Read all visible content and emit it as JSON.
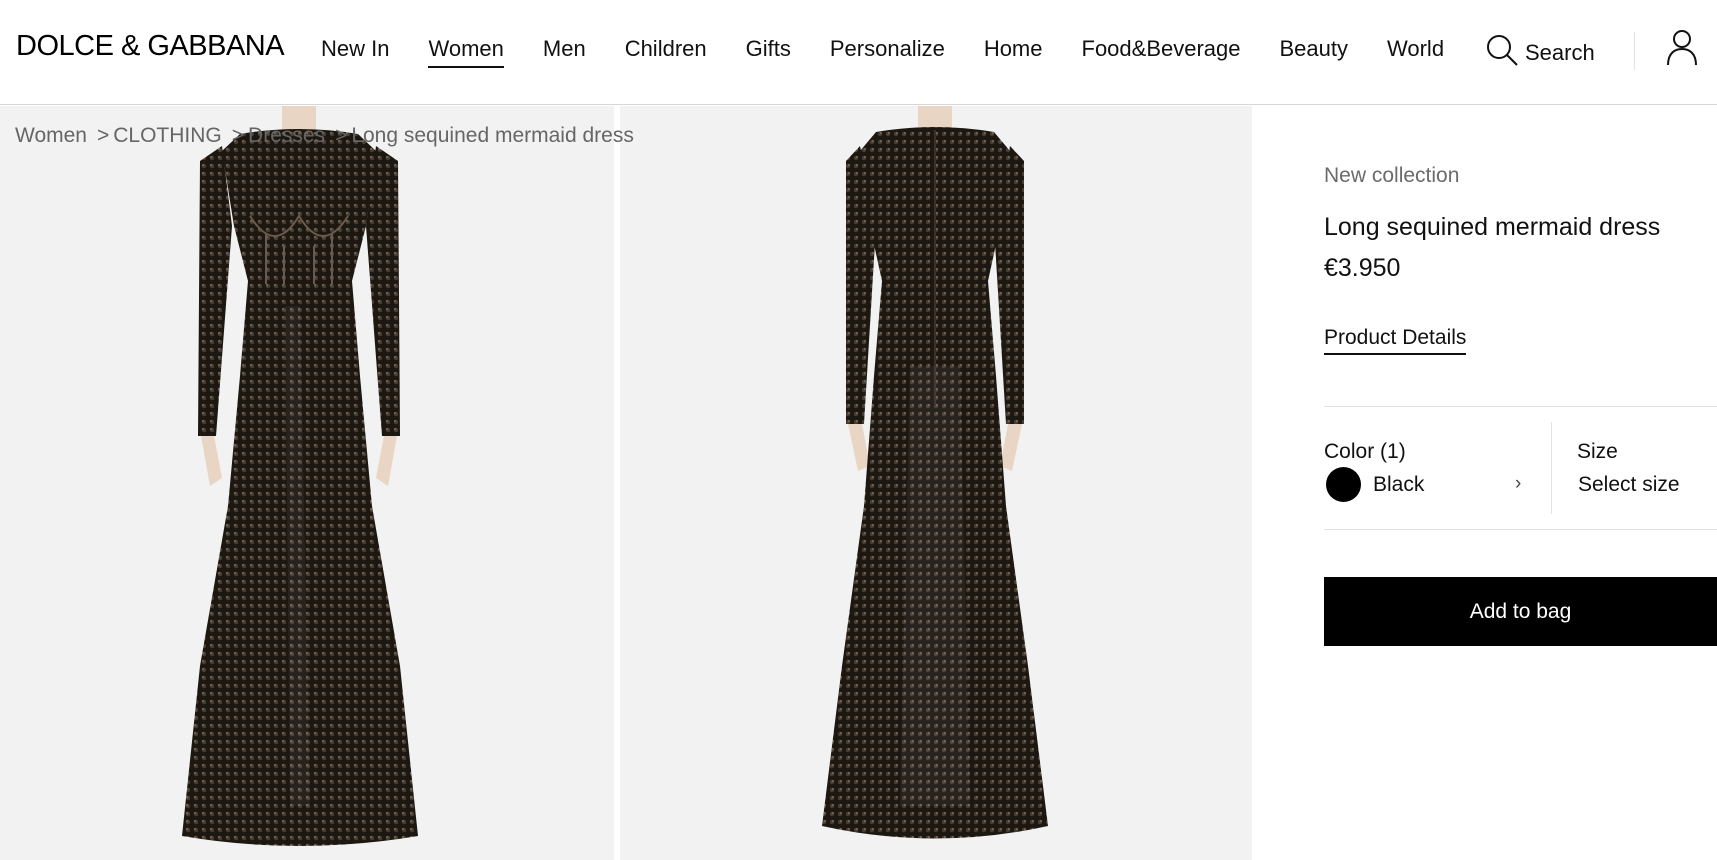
{
  "header": {
    "logo": "DOLCE & GABBANA",
    "nav": [
      "New In",
      "Women",
      "Men",
      "Children",
      "Gifts",
      "Personalize",
      "Home",
      "Food&Beverage",
      "Beauty",
      "World"
    ],
    "active_nav": "Women",
    "search_label": "Search"
  },
  "breadcrumb": {
    "items": [
      "Women",
      "CLOTHING",
      "Dresses"
    ],
    "separator": ">",
    "current": "Long sequined mermaid dress"
  },
  "product": {
    "collection": "New collection",
    "title": "Long sequined mermaid dress",
    "price": "€3.950",
    "details_link": "Product Details",
    "color_label": "Color (1)",
    "color_value": "Black",
    "color_swatch": "#000000",
    "size_label": "Size",
    "size_value": "Select size",
    "add_to_bag": "Add to bag"
  },
  "icons": {
    "search": "search-icon",
    "account": "user-icon",
    "chevron": "chevron-right-icon"
  },
  "colors": {
    "image_background": "#f2f2f2",
    "button_background": "#000000",
    "button_text": "#ffffff"
  }
}
